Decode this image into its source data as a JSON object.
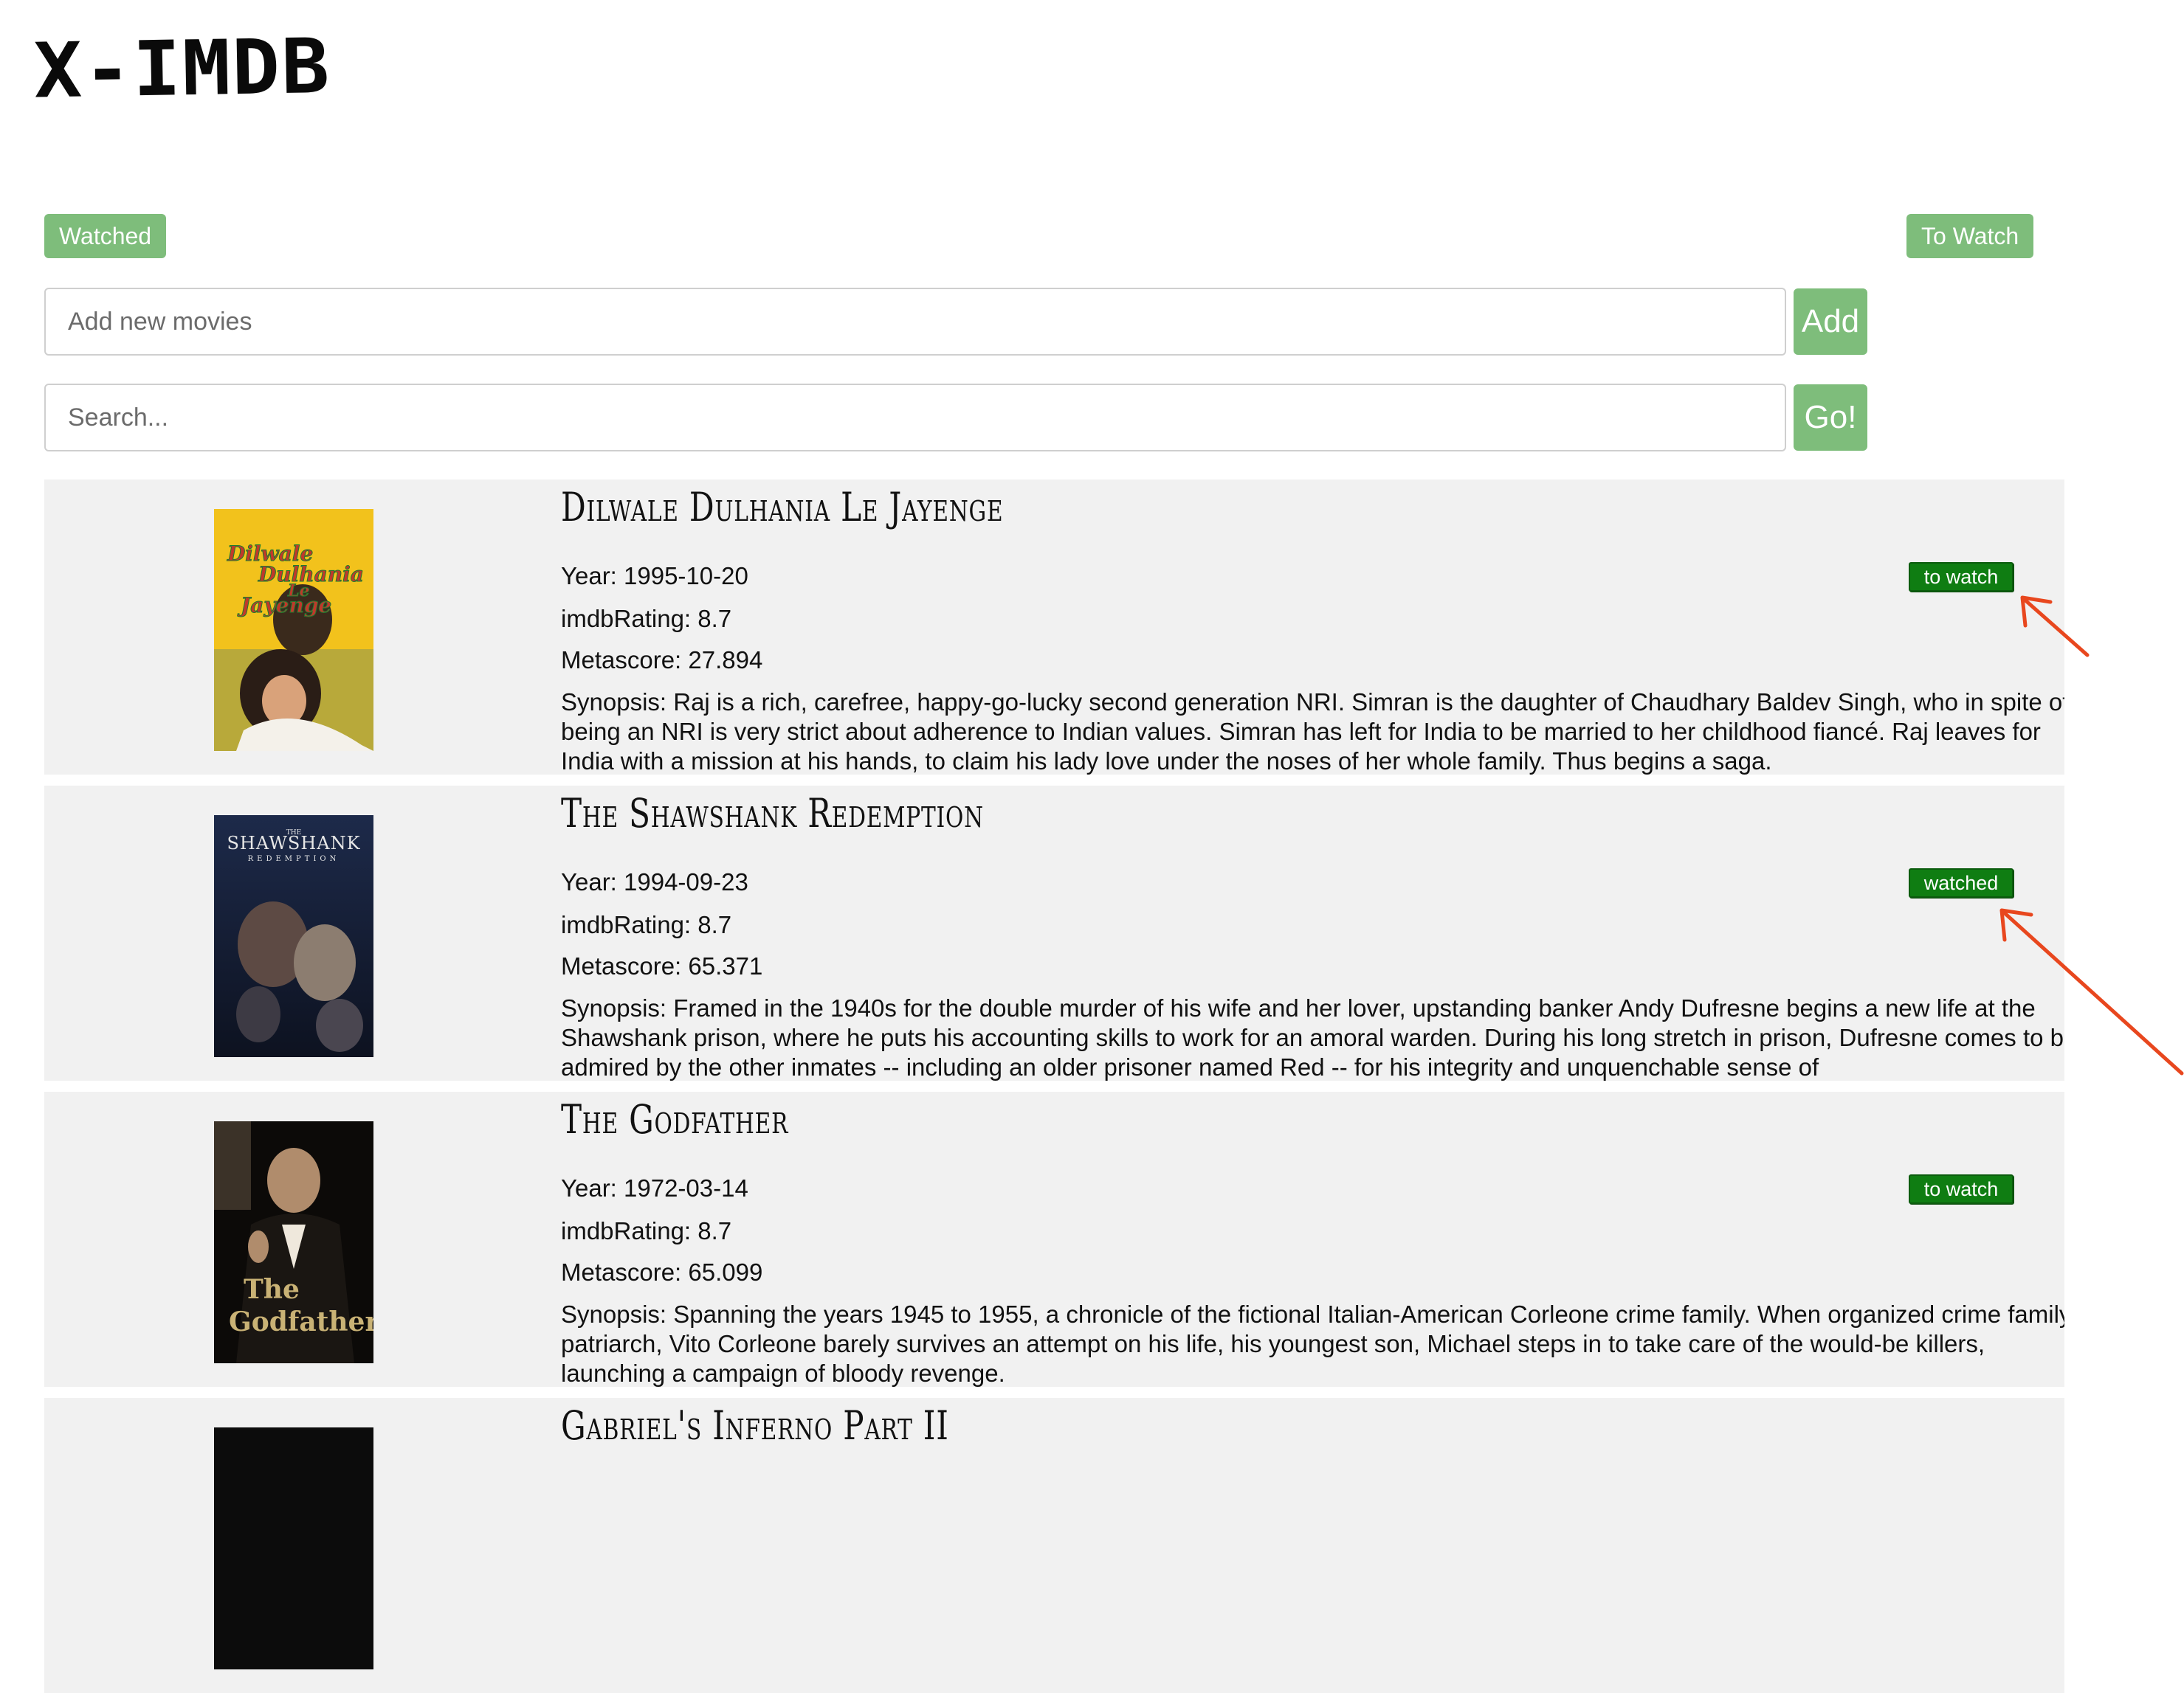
{
  "app": {
    "logo": "X-IMDB"
  },
  "tabs": {
    "watched_label": "Watched",
    "to_watch_label": "To Watch"
  },
  "add_movie": {
    "placeholder": "Add new movies",
    "button_label": "Add"
  },
  "search": {
    "placeholder": "Search...",
    "button_label": "Go!"
  },
  "movies": [
    {
      "title": "Dilwale Dulhania Le Jayenge",
      "year": "Year: 1995-10-20",
      "rating": "imdbRating: 8.7",
      "metascore": "Metascore: 27.894",
      "synopsis": "Synopsis: Raj is a rich, carefree, happy-go-lucky second generation NRI. Simran is the daughter of Chaudhary Baldev Singh, who in spite of being an NRI is very strict about adherence to Indian values. Simran has left for India to be married to her childhood fiancé. Raj leaves for India with a mission at his hands, to claim his lady love under the noses of her whole family. Thus begins a saga.",
      "status_button": "to watch"
    },
    {
      "title": "The Shawshank Redemption",
      "year": "Year: 1994-09-23",
      "rating": "imdbRating: 8.7",
      "metascore": "Metascore: 65.371",
      "synopsis": "Synopsis: Framed in the 1940s for the double murder of his wife and her lover, upstanding banker Andy Dufresne begins a new life at the Shawshank prison, where he puts his accounting skills to work for an amoral warden. During his long stretch in prison, Dufresne comes to be admired by the other inmates -- including an older prisoner named Red -- for his integrity and unquenchable sense of",
      "status_button": "watched"
    },
    {
      "title": "The Godfather",
      "year": "Year: 1972-03-14",
      "rating": "imdbRating: 8.7",
      "metascore": "Metascore: 65.099",
      "synopsis": "Synopsis: Spanning the years 1945 to 1955, a chronicle of the fictional Italian-American Corleone crime family. When organized crime family patriarch, Vito Corleone barely survives an attempt on his life, his youngest son, Michael steps in to take care of the would-be killers, launching a campaign of bloody revenge.",
      "status_button": "to watch"
    },
    {
      "title": "Gabriel's Inferno Part II",
      "year": "",
      "rating": "",
      "metascore": "",
      "synopsis": "",
      "status_button": ""
    }
  ],
  "posters": {
    "ddlj": {
      "line1": "Dilwale",
      "line2": "Dulhania",
      "line3": "Le",
      "line4": "Jayenge"
    },
    "shawshank": {
      "small": "THE",
      "name": "SHAWSHANK",
      "sub": "REDEMPTION"
    },
    "godfather": {
      "line1": "The",
      "line2": "Godfather"
    }
  },
  "colors": {
    "tab_green": "#7ebd7b",
    "status_green": "#0f7d12",
    "card_bg": "#f1f1f1",
    "annotation_arrow": "#e8471e"
  },
  "icons": [
    "annotation-arrow-icon"
  ]
}
